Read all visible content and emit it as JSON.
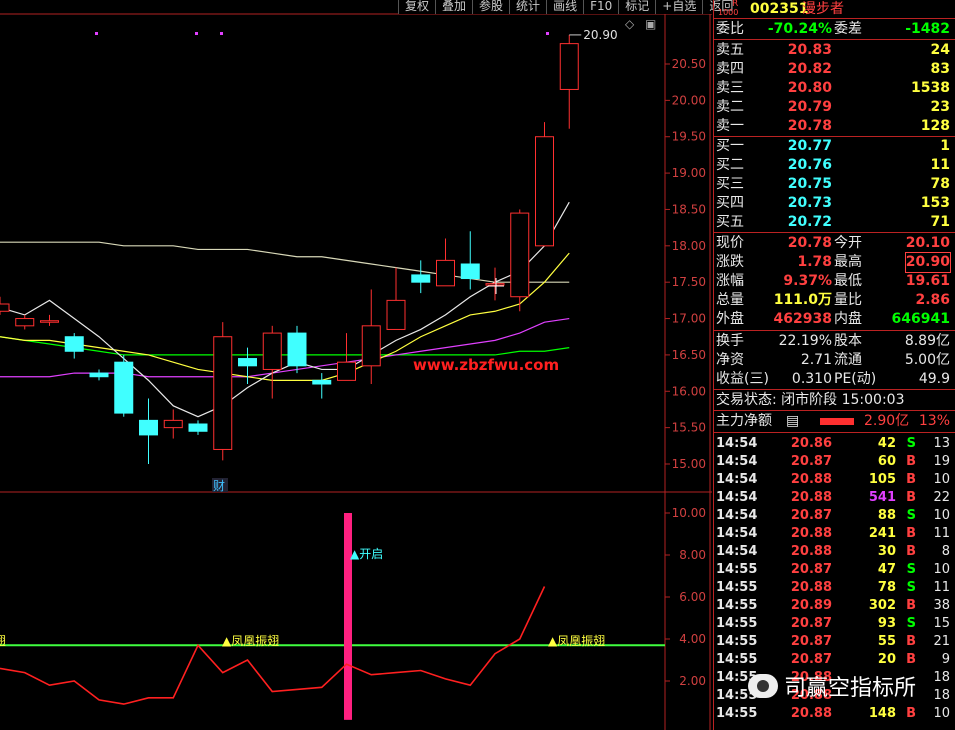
{
  "toolbar": {
    "items": [
      "复权",
      "叠加",
      "参股",
      "统计",
      "画线",
      "F10",
      "标记",
      "+自选",
      "返回"
    ]
  },
  "stock": {
    "code": "002351",
    "name": "漫步者",
    "badge_top": "R",
    "badge_bottom": "1000"
  },
  "colors": {
    "up": "#ff3030",
    "down": "#40ffff",
    "grid": "#b22222",
    "ma5": "#e8e8e8",
    "ma10": "#ffff40",
    "ma20": "#e040ff",
    "ma60": "#00ff00"
  },
  "chart_data": {
    "type": "candlestick",
    "y_axis_price": [
      "20.50",
      "20.00",
      "19.50",
      "19.00",
      "18.50",
      "18.00",
      "17.50",
      "17.00",
      "16.50",
      "16.00",
      "15.50",
      "15.00"
    ],
    "y_axis_indicator": [
      "10.00",
      "8.00",
      "6.00",
      "4.00",
      "2.00"
    ],
    "high_label": "20.90",
    "candles": [
      {
        "o": 17.1,
        "h": 17.3,
        "c": 17.2,
        "l": 17.05,
        "down": true
      },
      {
        "o": 16.9,
        "h": 17.05,
        "c": 17.0,
        "l": 16.85,
        "up": false
      },
      {
        "o": 16.97,
        "h": 17.05,
        "c": 16.97,
        "l": 16.9
      },
      {
        "o": 16.75,
        "h": 16.8,
        "c": 16.55,
        "l": 16.45
      },
      {
        "o": 16.25,
        "h": 16.3,
        "c": 16.2,
        "l": 16.15
      },
      {
        "o": 16.4,
        "h": 16.5,
        "c": 15.7,
        "l": 15.65
      },
      {
        "o": 15.6,
        "h": 15.9,
        "c": 15.4,
        "l": 15.0
      },
      {
        "o": 15.5,
        "h": 15.75,
        "c": 15.6,
        "l": 15.35
      },
      {
        "o": 15.55,
        "h": 15.6,
        "c": 15.45,
        "l": 15.4
      },
      {
        "o": 15.2,
        "h": 16.95,
        "c": 16.75,
        "l": 15.05
      },
      {
        "o": 16.45,
        "h": 16.6,
        "c": 16.35,
        "l": 16.1
      },
      {
        "o": 16.3,
        "h": 16.9,
        "c": 16.8,
        "l": 15.9
      },
      {
        "o": 16.8,
        "h": 16.9,
        "c": 16.35,
        "l": 16.25
      },
      {
        "o": 16.15,
        "h": 16.25,
        "c": 16.1,
        "l": 15.9
      },
      {
        "o": 16.15,
        "h": 16.8,
        "c": 16.4,
        "l": 16.15
      },
      {
        "o": 16.35,
        "h": 17.4,
        "c": 16.9,
        "l": 16.1
      },
      {
        "o": 16.85,
        "h": 17.7,
        "c": 17.25,
        "l": 16.85
      },
      {
        "o": 17.6,
        "h": 17.8,
        "c": 17.5,
        "l": 17.35
      },
      {
        "o": 17.45,
        "h": 18.1,
        "c": 17.8,
        "l": 17.45
      },
      {
        "o": 17.75,
        "h": 18.2,
        "c": 17.55,
        "l": 17.4
      },
      {
        "o": 17.48,
        "h": 17.7,
        "c": 17.48,
        "l": 17.25
      },
      {
        "o": 17.3,
        "h": 18.5,
        "c": 18.45,
        "l": 17.1
      },
      {
        "o": 18.0,
        "h": 19.7,
        "c": 19.5,
        "l": 18.45
      },
      {
        "o": 20.15,
        "h": 20.9,
        "c": 20.78,
        "l": 19.61
      }
    ],
    "candle_bodies": "up=hollow red, down=filled cyan",
    "ma5": [
      17.15,
      17.05,
      17.25,
      17.0,
      16.75,
      16.45,
      16.15,
      15.8,
      15.65,
      15.8,
      16.05,
      16.25,
      16.4,
      16.3,
      16.3,
      16.5,
      16.7,
      16.85,
      17.05,
      17.3,
      17.5,
      17.65,
      18.0,
      18.6
    ],
    "ma10": [
      16.75,
      16.7,
      16.7,
      16.65,
      16.6,
      16.55,
      16.5,
      16.4,
      16.3,
      16.25,
      16.2,
      16.15,
      16.15,
      16.15,
      16.25,
      16.4,
      16.55,
      16.75,
      16.9,
      17.05,
      17.1,
      17.2,
      17.5,
      17.9
    ],
    "ma20": [
      16.2,
      16.2,
      16.2,
      16.25,
      16.25,
      16.25,
      16.2,
      16.2,
      16.2,
      16.2,
      16.2,
      16.25,
      16.3,
      16.35,
      16.4,
      16.45,
      16.5,
      16.55,
      16.6,
      16.65,
      16.7,
      16.8,
      16.95,
      17.0
    ],
    "ma60": [
      16.75,
      16.7,
      16.65,
      16.6,
      16.55,
      16.5,
      16.5,
      16.5,
      16.5,
      16.5,
      16.5,
      16.5,
      16.5,
      16.5,
      16.5,
      16.5,
      16.5,
      16.5,
      16.5,
      16.5,
      16.5,
      16.55,
      16.55,
      16.6
    ],
    "ma120": [
      18.05,
      18.05,
      18.05,
      18.05,
      18.05,
      18.0,
      18.0,
      18.0,
      17.95,
      17.95,
      17.95,
      17.9,
      17.85,
      17.85,
      17.8,
      17.75,
      17.7,
      17.65,
      17.6,
      17.55,
      17.5,
      17.5,
      17.5,
      17.5
    ],
    "indicator_line": [
      2.6,
      2.4,
      1.8,
      2.0,
      1.1,
      0.9,
      1.2,
      1.2,
      3.7,
      2.4,
      3.0,
      1.5,
      1.6,
      1.7,
      2.8,
      2.3,
      2.4,
      2.5,
      2.1,
      1.8,
      3.3,
      4.0,
      6.5
    ],
    "indicator_threshold": 3.7,
    "signal_bar_value": 10.0,
    "signal_open_label": "开启",
    "fenghuang_label": "凤凰振翅",
    "fin_label": "财",
    "watermark_chart": "www.zbzfwu.com"
  },
  "quote": {
    "weibi_label": "委比",
    "weibi": "-70.24%",
    "weicha_label": "委差",
    "weicha": "-1482",
    "asks": [
      {
        "label": "卖五",
        "price": "20.83",
        "vol": "24"
      },
      {
        "label": "卖四",
        "price": "20.82",
        "vol": "83"
      },
      {
        "label": "卖三",
        "price": "20.80",
        "vol": "1538"
      },
      {
        "label": "卖二",
        "price": "20.79",
        "vol": "23"
      },
      {
        "label": "卖一",
        "price": "20.78",
        "vol": "128"
      }
    ],
    "bids": [
      {
        "label": "买一",
        "price": "20.77",
        "vol": "1"
      },
      {
        "label": "买二",
        "price": "20.76",
        "vol": "11"
      },
      {
        "label": "买三",
        "price": "20.75",
        "vol": "78"
      },
      {
        "label": "买四",
        "price": "20.73",
        "vol": "153"
      },
      {
        "label": "买五",
        "price": "20.72",
        "vol": "71"
      }
    ],
    "stats": [
      {
        "l1": "现价",
        "v1": "20.78",
        "c1": "red",
        "l2": "今开",
        "v2": "20.10",
        "c2": "red"
      },
      {
        "l1": "涨跌",
        "v1": "1.78",
        "c1": "red",
        "l2": "最高",
        "v2": "20.90",
        "c2": "red"
      },
      {
        "l1": "涨幅",
        "v1": "9.37%",
        "c1": "red",
        "l2": "最低",
        "v2": "19.61",
        "c2": "red"
      },
      {
        "l1": "总量",
        "v1": "111.0万",
        "c1": "yel",
        "l2": "量比",
        "v2": "2.86",
        "c2": "red"
      },
      {
        "l1": "外盘",
        "v1": "462938",
        "c1": "red",
        "l2": "内盘",
        "v2": "646941",
        "c2": "grn"
      }
    ],
    "stats2": [
      {
        "l1": "换手",
        "v1": "22.19%",
        "l2": "股本",
        "v2": "8.89亿"
      },
      {
        "l1": "净资",
        "v1": "2.71",
        "l2": "流通",
        "v2": "5.00亿"
      },
      {
        "l1": "收益(三)",
        "v1": "0.310",
        "l2": "PE(动)",
        "v2": "49.9"
      }
    ],
    "trade_status": "交易状态: 闭市阶段 15:00:03",
    "main_flow_label": "主力净额",
    "main_flow_value": "2.90亿",
    "main_flow_pct": "13%"
  },
  "ticks": [
    {
      "t": "14:54",
      "p": "20.86",
      "v": "42",
      "s": "S",
      "n": "13"
    },
    {
      "t": "14:54",
      "p": "20.87",
      "v": "60",
      "s": "B",
      "n": "19"
    },
    {
      "t": "14:54",
      "p": "20.88",
      "v": "105",
      "s": "B",
      "n": "10"
    },
    {
      "t": "14:54",
      "p": "20.88",
      "v": "541",
      "s": "B",
      "n": "22"
    },
    {
      "t": "14:54",
      "p": "20.87",
      "v": "88",
      "s": "S",
      "n": "10"
    },
    {
      "t": "14:54",
      "p": "20.88",
      "v": "241",
      "s": "B",
      "n": "11"
    },
    {
      "t": "14:54",
      "p": "20.88",
      "v": "30",
      "s": "B",
      "n": "8"
    },
    {
      "t": "14:55",
      "p": "20.87",
      "v": "47",
      "s": "S",
      "n": "10"
    },
    {
      "t": "14:55",
      "p": "20.88",
      "v": "78",
      "s": "S",
      "n": "11"
    },
    {
      "t": "14:55",
      "p": "20.89",
      "v": "302",
      "s": "B",
      "n": "38"
    },
    {
      "t": "14:55",
      "p": "20.87",
      "v": "93",
      "s": "S",
      "n": "15"
    },
    {
      "t": "14:55",
      "p": "20.87",
      "v": "55",
      "s": "B",
      "n": "21"
    },
    {
      "t": "14:55",
      "p": "20.87",
      "v": "20",
      "s": "B",
      "n": "9"
    },
    {
      "t": "14:55",
      "p": "20.88",
      "v": "",
      "s": "",
      "n": "18"
    },
    {
      "t": "14:55",
      "p": "20.88",
      "v": "",
      "s": "",
      "n": "18"
    },
    {
      "t": "14:55",
      "p": "20.88",
      "v": "148",
      "s": "B",
      "n": "10"
    }
  ],
  "watermark": {
    "text": "司赢空指标所"
  }
}
